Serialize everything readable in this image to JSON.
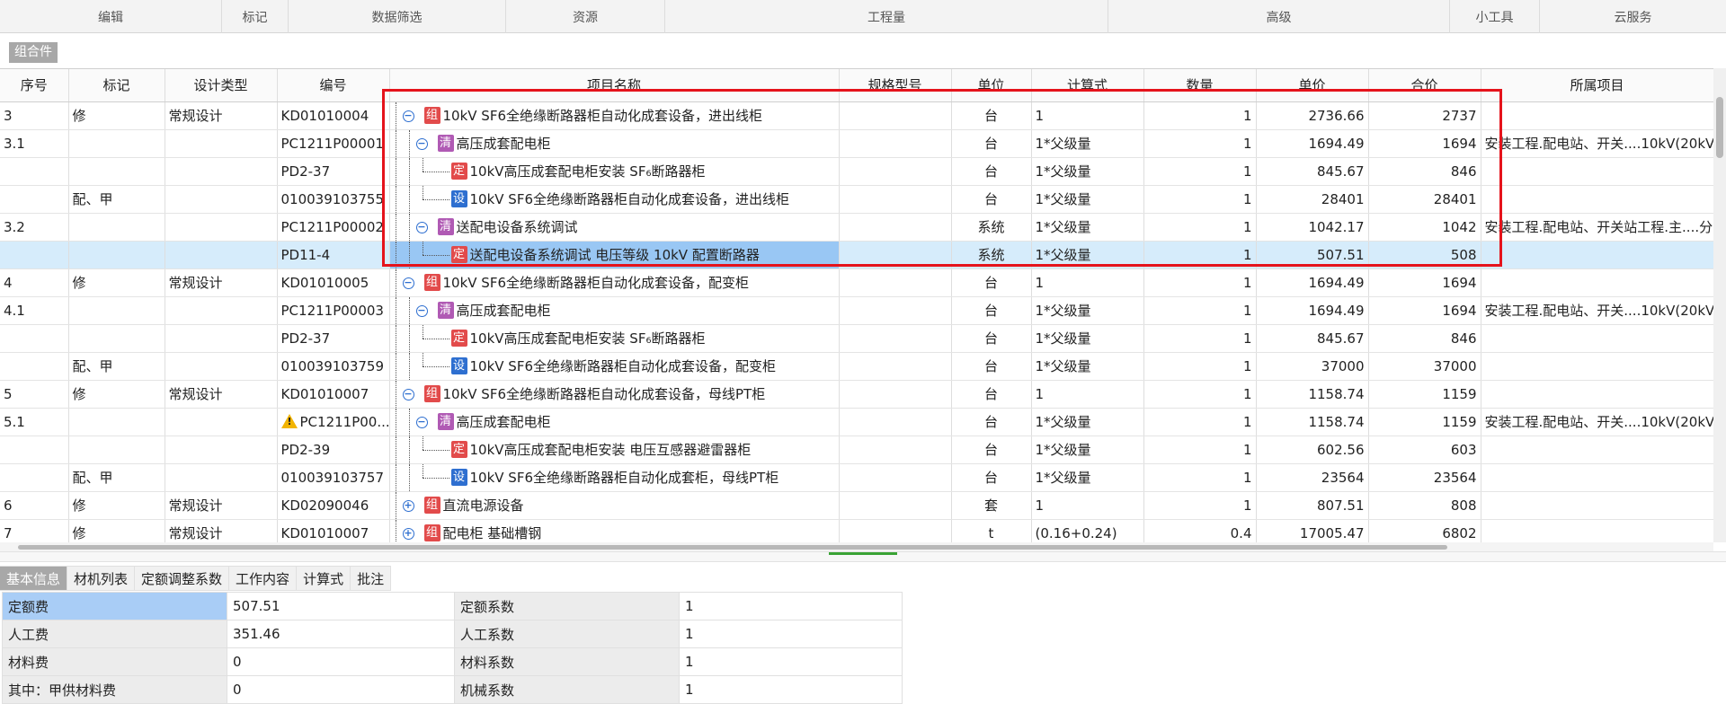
{
  "ribbon": {
    "groups": [
      "编辑",
      "标记",
      "数据筛选",
      "资源",
      "工程量",
      "高级",
      "小工具",
      "云服务"
    ]
  },
  "section_label": "组合件",
  "table": {
    "columns": [
      "序号",
      "标记",
      "设计类型",
      "编号",
      "项目名称",
      "规格型号",
      "单位",
      "计算式",
      "数量",
      "单价",
      "合价",
      "所属项目"
    ],
    "rows": [
      {
        "seq": "3",
        "mark": "修",
        "design": "常规设计",
        "code": "KD01010004",
        "level": 0,
        "toggle": "minus",
        "badge": "组",
        "badge_class": "b-zu",
        "name": "10kV SF6全绝缘断路器柜自动化成套设备，进出线柜",
        "spec": "",
        "unit": "台",
        "formula": "1",
        "qty": "1",
        "price": "2736.66",
        "total": "2737",
        "project": ""
      },
      {
        "seq": "3.1",
        "mark": "",
        "design": "",
        "code": "PC1211P00001",
        "level": 1,
        "toggle": "minus",
        "badge": "清",
        "badge_class": "b-qing",
        "name": "高压成套配电柜",
        "spec": "",
        "unit": "台",
        "formula": "1*父级量",
        "qty": "1",
        "price": "1694.49",
        "total": "1694",
        "project": "安装工程.配电站、开关....10kV(20kV"
      },
      {
        "seq": "",
        "mark": "",
        "design": "",
        "code": "PD2-37",
        "level": 2,
        "toggle": "",
        "badge": "定",
        "badge_class": "b-ding",
        "name": "10kV高压成套配电柜安装 SF₆断路器柜",
        "spec": "",
        "unit": "台",
        "formula": "1*父级量",
        "qty": "1",
        "price": "845.67",
        "total": "846",
        "project": ""
      },
      {
        "seq": "",
        "mark": "配、甲",
        "design": "",
        "code": "010039103755",
        "level": 2,
        "toggle": "",
        "badge": "设",
        "badge_class": "b-she",
        "name": "10kV SF6全绝缘断路器柜自动化成套设备，进出线柜",
        "spec": "",
        "unit": "台",
        "formula": "1*父级量",
        "qty": "1",
        "price": "28401",
        "total": "28401",
        "project": ""
      },
      {
        "seq": "3.2",
        "mark": "",
        "design": "",
        "code": "PC1211P00002",
        "level": 1,
        "toggle": "minus",
        "badge": "清",
        "badge_class": "b-qing",
        "name": "送配电设备系统调试",
        "spec": "",
        "unit": "系统",
        "formula": "1*父级量",
        "qty": "1",
        "price": "1042.17",
        "total": "1042",
        "project": "安装工程.配电站、开关站工程.主....分"
      },
      {
        "seq": "",
        "mark": "",
        "design": "",
        "code": "PD11-4",
        "level": 2,
        "toggle": "",
        "badge": "定",
        "badge_class": "b-ding",
        "name": "送配电设备系统调试 电压等级 10kV 配置断路器",
        "spec": "",
        "unit": "系统",
        "formula": "1*父级量",
        "qty": "1",
        "price": "507.51",
        "total": "508",
        "project": "",
        "selected": true
      },
      {
        "seq": "4",
        "mark": "修",
        "design": "常规设计",
        "code": "KD01010005",
        "level": 0,
        "toggle": "minus",
        "badge": "组",
        "badge_class": "b-zu",
        "name": "10kV SF6全绝缘断路器柜自动化成套设备，配变柜",
        "spec": "",
        "unit": "台",
        "formula": "1",
        "qty": "1",
        "price": "1694.49",
        "total": "1694",
        "project": ""
      },
      {
        "seq": "4.1",
        "mark": "",
        "design": "",
        "code": "PC1211P00003",
        "level": 1,
        "toggle": "minus",
        "badge": "清",
        "badge_class": "b-qing",
        "name": "高压成套配电柜",
        "spec": "",
        "unit": "台",
        "formula": "1*父级量",
        "qty": "1",
        "price": "1694.49",
        "total": "1694",
        "project": "安装工程.配电站、开关....10kV(20kV"
      },
      {
        "seq": "",
        "mark": "",
        "design": "",
        "code": "PD2-37",
        "level": 2,
        "toggle": "",
        "badge": "定",
        "badge_class": "b-ding",
        "name": "10kV高压成套配电柜安装 SF₆断路器柜",
        "spec": "",
        "unit": "台",
        "formula": "1*父级量",
        "qty": "1",
        "price": "845.67",
        "total": "846",
        "project": ""
      },
      {
        "seq": "",
        "mark": "配、甲",
        "design": "",
        "code": "010039103759",
        "level": 2,
        "toggle": "",
        "badge": "设",
        "badge_class": "b-she",
        "name": "10kV SF6全绝缘断路器柜自动化成套设备，配变柜",
        "spec": "",
        "unit": "台",
        "formula": "1*父级量",
        "qty": "1",
        "price": "37000",
        "total": "37000",
        "project": ""
      },
      {
        "seq": "5",
        "mark": "修",
        "design": "常规设计",
        "code": "KD01010007",
        "level": 0,
        "toggle": "minus",
        "badge": "组",
        "badge_class": "b-zu",
        "name": "10kV SF6全绝缘断路器柜自动化成套设备，母线PT柜",
        "spec": "",
        "unit": "台",
        "formula": "1",
        "qty": "1",
        "price": "1158.74",
        "total": "1159",
        "project": ""
      },
      {
        "seq": "5.1",
        "mark": "",
        "design": "",
        "code": "PC1211P00...",
        "warn": true,
        "level": 1,
        "toggle": "minus",
        "badge": "清",
        "badge_class": "b-qing",
        "name": "高压成套配电柜",
        "spec": "",
        "unit": "台",
        "formula": "1*父级量",
        "qty": "1",
        "price": "1158.74",
        "total": "1159",
        "project": "安装工程.配电站、开关....10kV(20kV"
      },
      {
        "seq": "",
        "mark": "",
        "design": "",
        "code": "PD2-39",
        "level": 2,
        "toggle": "",
        "badge": "定",
        "badge_class": "b-ding",
        "name": "10kV高压成套配电柜安装 电压互感器避雷器柜",
        "spec": "",
        "unit": "台",
        "formula": "1*父级量",
        "qty": "1",
        "price": "602.56",
        "total": "603",
        "project": ""
      },
      {
        "seq": "",
        "mark": "配、甲",
        "design": "",
        "code": "010039103757",
        "level": 2,
        "toggle": "",
        "badge": "设",
        "badge_class": "b-she",
        "name": "10kV SF6全绝缘断路器柜自动化成套柜，母线PT柜",
        "spec": "",
        "unit": "台",
        "formula": "1*父级量",
        "qty": "1",
        "price": "23564",
        "total": "23564",
        "project": ""
      },
      {
        "seq": "6",
        "mark": "修",
        "design": "常规设计",
        "code": "KD02090046",
        "level": 0,
        "toggle": "plus",
        "badge": "组",
        "badge_class": "b-zu",
        "name": "直流电源设备",
        "spec": "",
        "unit": "套",
        "formula": "1",
        "qty": "1",
        "price": "807.51",
        "total": "808",
        "project": ""
      },
      {
        "seq": "7",
        "mark": "修",
        "design": "常规设计",
        "code": "KD01010007",
        "level": 0,
        "toggle": "plus",
        "badge": "组",
        "badge_class": "b-zu",
        "name": "配电柜 基础槽钢",
        "spec": "",
        "unit": "t",
        "formula": "(0.16+0.24)",
        "qty": "0.4",
        "price": "17005.47",
        "total": "6802",
        "project": ""
      }
    ]
  },
  "bottom_tabs": [
    "基本信息",
    "材机列表",
    "定额调整系数",
    "工作内容",
    "计算式",
    "批注"
  ],
  "info": [
    {
      "label1": "定额费",
      "value1": "507.51",
      "label2": "定额系数",
      "value2": "1"
    },
    {
      "label1": "人工费",
      "value1": "351.46",
      "label2": "人工系数",
      "value2": "1"
    },
    {
      "label1": "材料费",
      "value1": "0",
      "label2": "材料系数",
      "value2": "1"
    },
    {
      "label1": "其中：甲供材料费",
      "value1": "0",
      "label2": "机械系数",
      "value2": "1"
    }
  ]
}
